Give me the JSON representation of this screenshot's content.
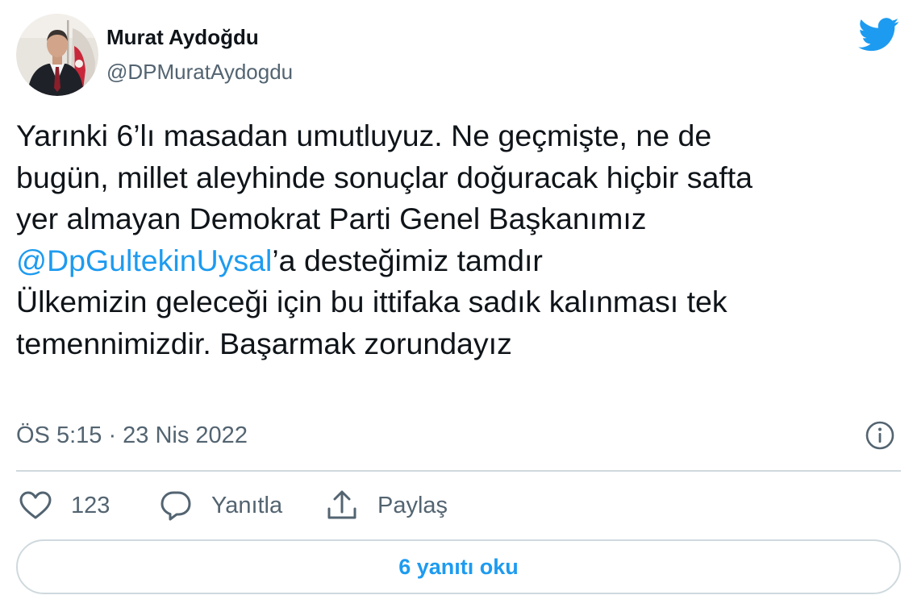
{
  "author": {
    "name": "Murat Aydoğdu",
    "handle": "@DPMuratAydogdu",
    "avatar_icon": "profile-photo"
  },
  "brand": {
    "icon": "twitter-bird-icon",
    "color": "#1d9bf0"
  },
  "tweet": {
    "paragraph1": {
      "line1": "Yarınki 6’lı masadan umutluyuz. Ne geçmişte, ne de",
      "line2": "bugün, millet aleyhinde sonuçlar doğuracak hiçbir safta",
      "line3": "yer almayan Demokrat Parti Genel Başkanımız",
      "mention": "@DpGultekinUysal",
      "line4_rest": "’a desteğimiz tamdır"
    },
    "paragraph2": {
      "line1": "Ülkemizin geleceği için bu ittifaka sadık kalınması tek",
      "line2": "temennimizdir. Başarmak zorundayız"
    },
    "timestamp": "ÖS 5:15 · 23 Nis 2022",
    "info_icon": "info-icon"
  },
  "actions": {
    "like_count": "123",
    "reply_label": "Yanıtla",
    "share_label": "Paylaş"
  },
  "replies_button": {
    "label": "6 yanıtı oku"
  },
  "colors": {
    "text": "#0f1419",
    "secondary": "#536471",
    "accent": "#1d9bf0",
    "border": "#cfd9de"
  }
}
